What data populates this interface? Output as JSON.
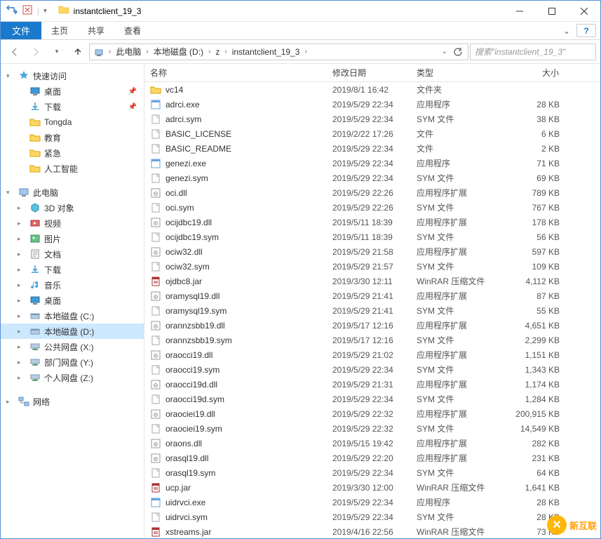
{
  "window": {
    "title": "instantclient_19_3"
  },
  "ribbon": {
    "file": "文件",
    "tabs": [
      "主页",
      "共享",
      "查看"
    ]
  },
  "address": {
    "segments": [
      "此电脑",
      "本地磁盘 (D:)",
      "z",
      "instantclient_19_3"
    ]
  },
  "search": {
    "placeholder": "搜索\"instantclient_19_3\""
  },
  "columns": {
    "name": "名称",
    "date": "修改日期",
    "type": "类型",
    "size": "大小"
  },
  "tree": {
    "quick": {
      "label": "快速访问",
      "items": [
        {
          "icon": "desktop",
          "label": "桌面",
          "pin": true
        },
        {
          "icon": "downloads",
          "label": "下载",
          "pin": true
        },
        {
          "icon": "folder",
          "label": "Tongda",
          "pin": false
        },
        {
          "icon": "folder",
          "label": "教育",
          "pin": false
        },
        {
          "icon": "folder",
          "label": "紧急",
          "pin": false
        },
        {
          "icon": "folder",
          "label": "人工智能",
          "pin": false
        }
      ]
    },
    "pc": {
      "label": "此电脑",
      "items": [
        {
          "icon": "3d",
          "label": "3D 对象"
        },
        {
          "icon": "video",
          "label": "视频"
        },
        {
          "icon": "pictures",
          "label": "图片"
        },
        {
          "icon": "documents",
          "label": "文档"
        },
        {
          "icon": "downloads",
          "label": "下载"
        },
        {
          "icon": "music",
          "label": "音乐"
        },
        {
          "icon": "desktop",
          "label": "桌面"
        },
        {
          "icon": "drive",
          "label": "本地磁盘 (C:)"
        },
        {
          "icon": "drive",
          "label": "本地磁盘 (D:)",
          "sel": true
        },
        {
          "icon": "netdrive",
          "label": "公共网盘 (X:)"
        },
        {
          "icon": "netdrive",
          "label": "部门网盘 (Y:)"
        },
        {
          "icon": "netdrive",
          "label": "个人网盘 (Z:)"
        }
      ]
    },
    "network": {
      "label": "网络"
    }
  },
  "files": [
    {
      "icon": "folder",
      "name": "vc14",
      "date": "2019/8/1 16:42",
      "type": "文件夹",
      "size": ""
    },
    {
      "icon": "exe",
      "name": "adrci.exe",
      "date": "2019/5/29 22:34",
      "type": "应用程序",
      "size": "28 KB"
    },
    {
      "icon": "file",
      "name": "adrci.sym",
      "date": "2019/5/29 22:34",
      "type": "SYM 文件",
      "size": "38 KB"
    },
    {
      "icon": "file",
      "name": "BASIC_LICENSE",
      "date": "2019/2/22 17:26",
      "type": "文件",
      "size": "6 KB"
    },
    {
      "icon": "file",
      "name": "BASIC_README",
      "date": "2019/5/29 22:34",
      "type": "文件",
      "size": "2 KB"
    },
    {
      "icon": "exe",
      "name": "genezi.exe",
      "date": "2019/5/29 22:34",
      "type": "应用程序",
      "size": "71 KB"
    },
    {
      "icon": "file",
      "name": "genezi.sym",
      "date": "2019/5/29 22:34",
      "type": "SYM 文件",
      "size": "69 KB"
    },
    {
      "icon": "dll",
      "name": "oci.dll",
      "date": "2019/5/29 22:26",
      "type": "应用程序扩展",
      "size": "789 KB"
    },
    {
      "icon": "file",
      "name": "oci.sym",
      "date": "2019/5/29 22:26",
      "type": "SYM 文件",
      "size": "767 KB"
    },
    {
      "icon": "dll",
      "name": "ocijdbc19.dll",
      "date": "2019/5/11 18:39",
      "type": "应用程序扩展",
      "size": "178 KB"
    },
    {
      "icon": "file",
      "name": "ocijdbc19.sym",
      "date": "2019/5/11 18:39",
      "type": "SYM 文件",
      "size": "56 KB"
    },
    {
      "icon": "dll",
      "name": "ociw32.dll",
      "date": "2019/5/29 21:58",
      "type": "应用程序扩展",
      "size": "597 KB"
    },
    {
      "icon": "file",
      "name": "ociw32.sym",
      "date": "2019/5/29 21:57",
      "type": "SYM 文件",
      "size": "109 KB"
    },
    {
      "icon": "rar",
      "name": "ojdbc8.jar",
      "date": "2019/3/30 12:11",
      "type": "WinRAR 压缩文件",
      "size": "4,112 KB"
    },
    {
      "icon": "dll",
      "name": "oramysql19.dll",
      "date": "2019/5/29 21:41",
      "type": "应用程序扩展",
      "size": "87 KB"
    },
    {
      "icon": "file",
      "name": "oramysql19.sym",
      "date": "2019/5/29 21:41",
      "type": "SYM 文件",
      "size": "55 KB"
    },
    {
      "icon": "dll",
      "name": "orannzsbb19.dll",
      "date": "2019/5/17 12:16",
      "type": "应用程序扩展",
      "size": "4,651 KB"
    },
    {
      "icon": "file",
      "name": "orannzsbb19.sym",
      "date": "2019/5/17 12:16",
      "type": "SYM 文件",
      "size": "2,299 KB"
    },
    {
      "icon": "dll",
      "name": "oraocci19.dll",
      "date": "2019/5/29 21:02",
      "type": "应用程序扩展",
      "size": "1,151 KB"
    },
    {
      "icon": "file",
      "name": "oraocci19.sym",
      "date": "2019/5/29 22:34",
      "type": "SYM 文件",
      "size": "1,343 KB"
    },
    {
      "icon": "dll",
      "name": "oraocci19d.dll",
      "date": "2019/5/29 21:31",
      "type": "应用程序扩展",
      "size": "1,174 KB"
    },
    {
      "icon": "file",
      "name": "oraocci19d.sym",
      "date": "2019/5/29 22:34",
      "type": "SYM 文件",
      "size": "1,284 KB"
    },
    {
      "icon": "dll",
      "name": "oraociei19.dll",
      "date": "2019/5/29 22:32",
      "type": "应用程序扩展",
      "size": "200,915 KB"
    },
    {
      "icon": "file",
      "name": "oraociei19.sym",
      "date": "2019/5/29 22:32",
      "type": "SYM 文件",
      "size": "14,549 KB"
    },
    {
      "icon": "dll",
      "name": "oraons.dll",
      "date": "2019/5/15 19:42",
      "type": "应用程序扩展",
      "size": "282 KB"
    },
    {
      "icon": "dll",
      "name": "orasql19.dll",
      "date": "2019/5/29 22:20",
      "type": "应用程序扩展",
      "size": "231 KB"
    },
    {
      "icon": "file",
      "name": "orasql19.sym",
      "date": "2019/5/29 22:34",
      "type": "SYM 文件",
      "size": "64 KB"
    },
    {
      "icon": "rar",
      "name": "ucp.jar",
      "date": "2019/3/30 12:00",
      "type": "WinRAR 压缩文件",
      "size": "1,641 KB"
    },
    {
      "icon": "exe",
      "name": "uidrvci.exe",
      "date": "2019/5/29 22:34",
      "type": "应用程序",
      "size": "28 KB"
    },
    {
      "icon": "file",
      "name": "uidrvci.sym",
      "date": "2019/5/29 22:34",
      "type": "SYM 文件",
      "size": "28 KB"
    },
    {
      "icon": "rar",
      "name": "xstreams.jar",
      "date": "2019/4/16 22:56",
      "type": "WinRAR 压缩文件",
      "size": "73 KB"
    }
  ],
  "watermark": "新互联"
}
